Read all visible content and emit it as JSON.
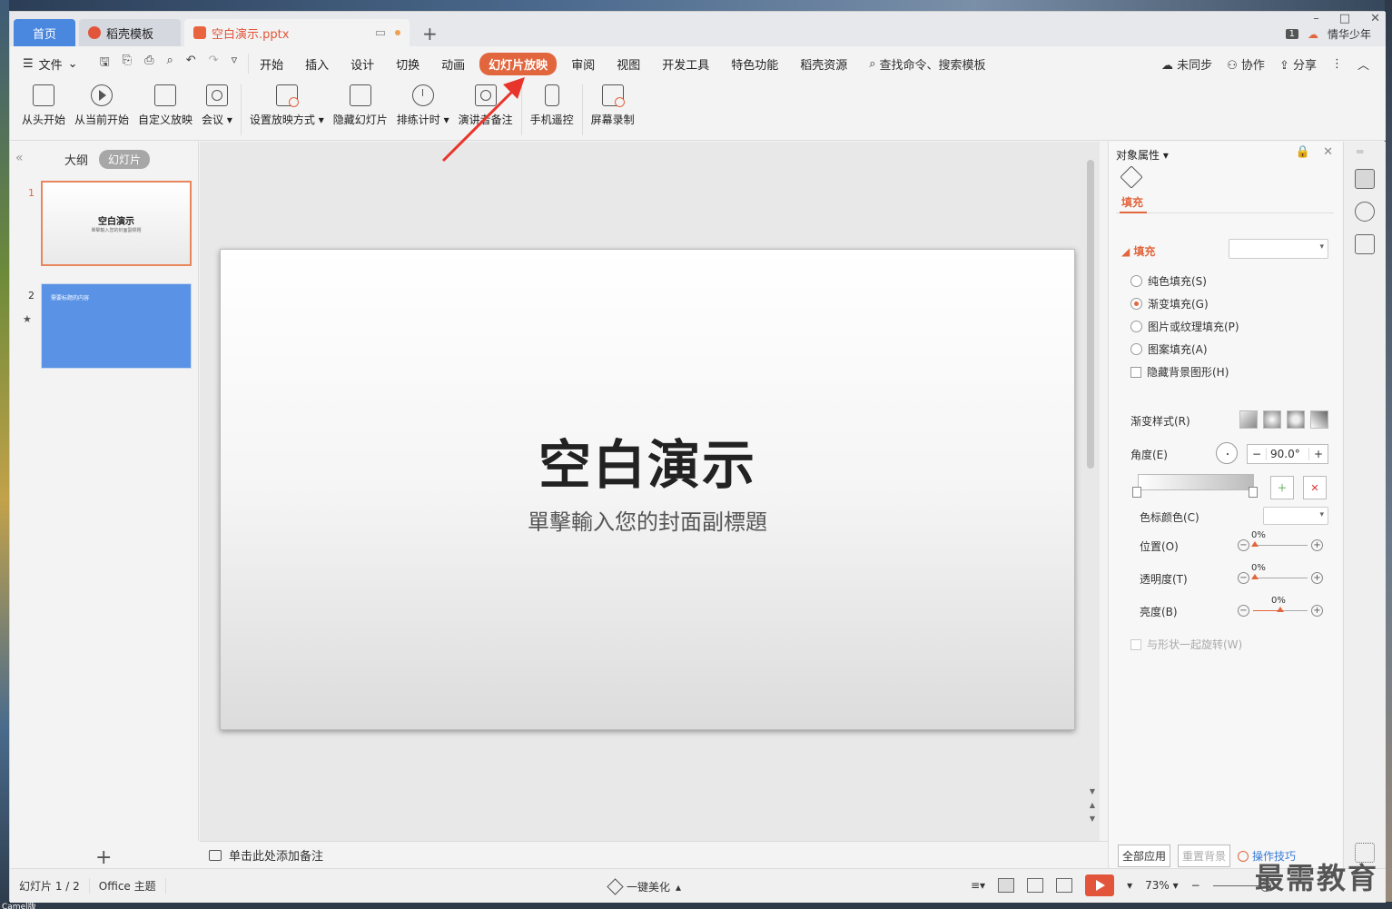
{
  "tabs": {
    "home": "首页",
    "template": "稻壳模板",
    "document": "空白演示.pptx"
  },
  "title_right": {
    "badge": "1",
    "user": "情华少年"
  },
  "menu": {
    "file": "文件",
    "items": [
      "开始",
      "插入",
      "设计",
      "切换",
      "动画",
      "幻灯片放映",
      "审阅",
      "视图",
      "开发工具",
      "特色功能",
      "稻壳资源"
    ],
    "active": "幻灯片放映",
    "search": "查找命令、搜索模板",
    "sync": "未同步",
    "collab": "协作",
    "share": "分享"
  },
  "ribbon": [
    {
      "label": "从头开始",
      "icon": "screen-play-icon"
    },
    {
      "label": "从当前开始",
      "icon": "play-circle-icon"
    },
    {
      "label": "自定义放映",
      "icon": "custom-show-icon"
    },
    {
      "label": "会议",
      "icon": "meeting-icon"
    },
    {
      "label": "设置放映方式",
      "icon": "slideshow-settings-icon"
    },
    {
      "label": "隐藏幻灯片",
      "icon": "hide-slide-icon"
    },
    {
      "label": "排练计时",
      "icon": "timer-icon"
    },
    {
      "label": "演讲者备注",
      "icon": "speaker-notes-icon"
    },
    {
      "label": "手机遥控",
      "icon": "phone-remote-icon"
    },
    {
      "label": "屏幕录制",
      "icon": "screen-record-icon"
    }
  ],
  "left_panel": {
    "tab_outline": "大纲",
    "tab_slides": "幻灯片",
    "slides": [
      {
        "num": "1",
        "title": "空白演示",
        "subtitle": "單擊輸入您的封面副標題"
      },
      {
        "num": "2",
        "title": "需要标题的内容"
      }
    ]
  },
  "slide": {
    "title": "空白演示",
    "subtitle": "單擊輸入您的封面副標題"
  },
  "notes_placeholder": "单击此处添加备注",
  "properties": {
    "title": "对象属性",
    "tab_fill": "填充",
    "section_fill": "填充",
    "options": [
      "纯色填充(S)",
      "渐变填充(G)",
      "图片或纹理填充(P)",
      "图案填充(A)"
    ],
    "selected": "渐变填充(G)",
    "hide_bg": "隐藏背景图形(H)",
    "gradient_style": "渐变样式(R)",
    "angle_label": "角度(E)",
    "angle_value": "90.0°",
    "stop_color": "色标颜色(C)",
    "position": "位置(O)",
    "transparency": "透明度(T)",
    "brightness": "亮度(B)",
    "position_value": "0%",
    "transparency_value": "0%",
    "brightness_value": "0%",
    "rotate_with_shape": "与形状一起旋转(W)",
    "apply_all": "全部应用",
    "reset_bg": "重置背景",
    "tips": "操作技巧"
  },
  "status": {
    "slide_count": "幻灯片 1 / 2",
    "theme": "Office 主题",
    "beautify": "一键美化",
    "zoom": "73%"
  },
  "watermark": "最需教育",
  "desktop_label": "Camel版"
}
